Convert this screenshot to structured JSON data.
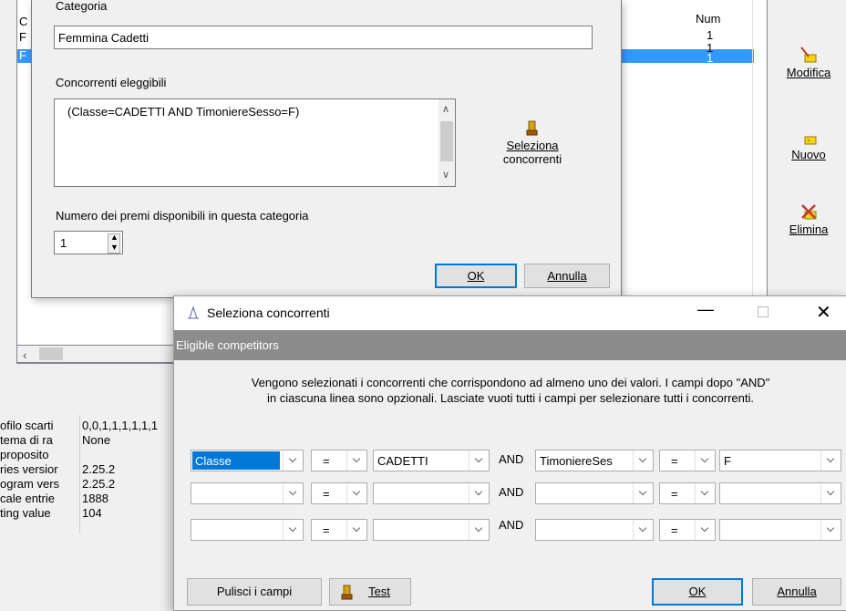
{
  "background": {
    "list_header_num": "Num",
    "list_rows": [
      {
        "c": "C",
        "num": "1"
      },
      {
        "c": "F",
        "num": "1"
      },
      {
        "c": "F",
        "num": "1"
      }
    ],
    "buttons": {
      "modifica": "Modifica",
      "nuovo": "Nuovo",
      "elimina": "Elimina"
    },
    "properties": [
      {
        "key": "ofilo scarti",
        "value": "0,0,1,1,1,1,1,1"
      },
      {
        "key": "tema di ra",
        "value": "None"
      },
      {
        "key": "proposito",
        "value": ""
      },
      {
        "key": "ries versior",
        "value": "2.25.2"
      },
      {
        "key": "ogram vers",
        "value": "2.25.2"
      },
      {
        "key": "cale entrie",
        "value": "1888"
      },
      {
        "key": "ting value",
        "value": "104"
      }
    ]
  },
  "category_dialog": {
    "category_label": "Categoria",
    "category_value": "Femmina Cadetti",
    "eligible_label": "Concorrenti eleggibili",
    "eligible_value": "(Classe=CADETTI AND TimoniereSesso=F)",
    "select_btn_line1": "Seleziona",
    "select_btn_line2": "concorrenti",
    "prizes_label": "Numero dei premi disponibili in questa categoria",
    "prizes_value": "1",
    "ok": "OK",
    "cancel": "Annulla"
  },
  "select_dialog": {
    "title": "Seleziona concorrenti",
    "header": "Eligible competitors",
    "info_line1": "Vengono selezionati i concorrenti che corrispondono ad almeno uno dei valori. I campi dopo \"AND\"",
    "info_line2": "in ciascuna linea sono opzionali. Lasciate vuoti tutti i campi per selezionare tutti i concorrenti.",
    "and_label": "AND",
    "rows": [
      {
        "field1": "Classe",
        "op1": "=",
        "value1": "CADETTI",
        "field2": "TimoniereSes",
        "op2": "=",
        "value2": "F"
      },
      {
        "field1": "",
        "op1": "=",
        "value1": "",
        "field2": "",
        "op2": "=",
        "value2": ""
      },
      {
        "field1": "",
        "op1": "=",
        "value1": "",
        "field2": "",
        "op2": "=",
        "value2": ""
      }
    ],
    "clear_btn": "Pulisci i campi",
    "test_btn": "Test",
    "ok": "OK",
    "cancel": "Annulla",
    "accent_color": "#0078d7",
    "header_color": "#8c8c8c",
    "selection_color": "#3399ff"
  }
}
